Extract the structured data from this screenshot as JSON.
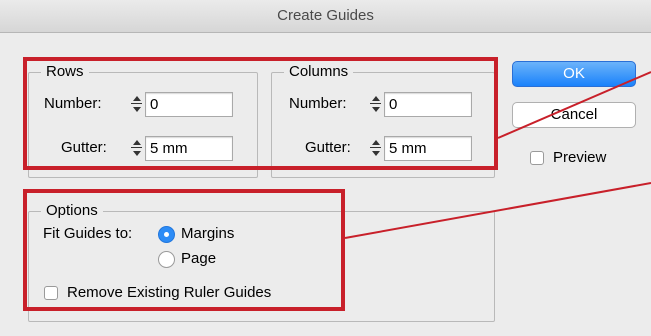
{
  "window": {
    "title": "Create Guides"
  },
  "rows": {
    "legend": "Rows",
    "number_label": "Number:",
    "number_value": "0",
    "gutter_label": "Gutter:",
    "gutter_value": "5 mm"
  },
  "columns": {
    "legend": "Columns",
    "number_label": "Number:",
    "number_value": "0",
    "gutter_label": "Gutter:",
    "gutter_value": "5 mm"
  },
  "options": {
    "legend": "Options",
    "fit_label": "Fit Guides to:",
    "fit_choices": [
      {
        "label": "Margins",
        "selected": true
      },
      {
        "label": "Page",
        "selected": false
      }
    ],
    "remove_label": "Remove Existing Ruler Guides",
    "remove_checked": false
  },
  "buttons": {
    "ok": "OK",
    "cancel": "Cancel"
  },
  "preview": {
    "label": "Preview",
    "checked": false
  },
  "colors": {
    "highlight": "#c8202a",
    "accent": "#1a82fb",
    "background": "#ececec"
  }
}
